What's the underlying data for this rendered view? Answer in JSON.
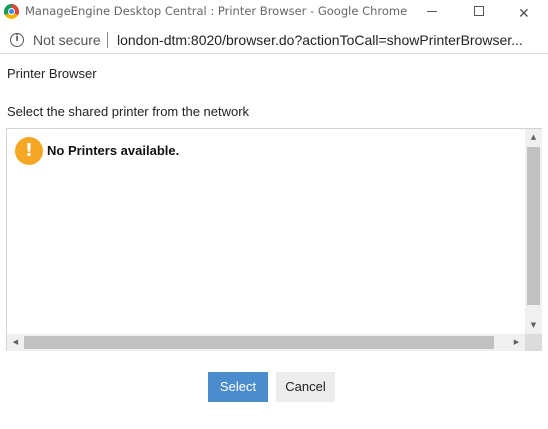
{
  "window": {
    "title": "ManageEngine Desktop Central : Printer Browser - Google Chrome",
    "minimize_glyph": "",
    "close_glyph": "✕"
  },
  "address_bar": {
    "info_glyph": "i",
    "security_label": "Not secure",
    "url": "london-dtm:8020/browser.do?actionToCall=showPrinterBrowser..."
  },
  "page": {
    "heading": "Printer Browser",
    "instruction": "Select the shared printer from the network",
    "warning_glyph": "!",
    "empty_message": "No Printers available."
  },
  "scrollbars": {
    "up_glyph": "▲",
    "down_glyph": "▼",
    "left_glyph": "◀",
    "right_glyph": "▶"
  },
  "buttons": {
    "select_label": "Select",
    "cancel_label": "Cancel"
  },
  "colors": {
    "primary_button": "#4a8ccc",
    "warning": "#f5a623"
  },
  "icons": {
    "browser": "chrome-logo-icon",
    "security": "info-icon",
    "warning": "warning-icon"
  }
}
